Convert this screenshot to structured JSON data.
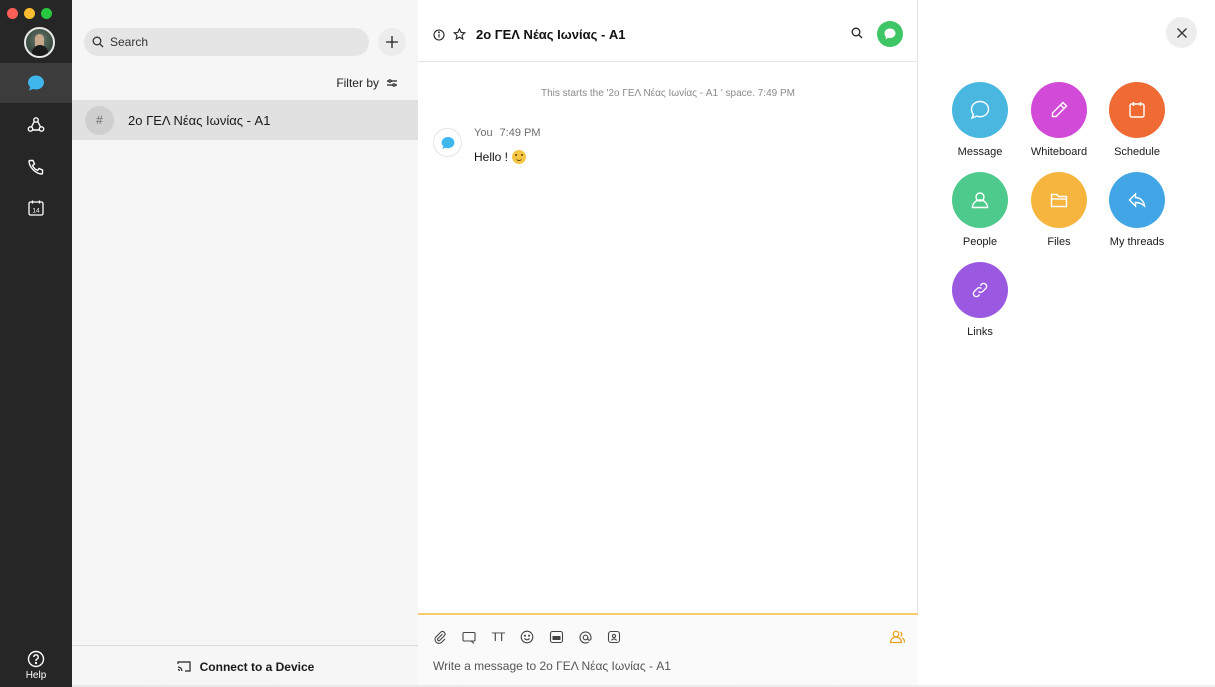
{
  "nav": {
    "help_label": "Help",
    "items": [
      {
        "name": "messaging",
        "icon": "chat-bubble-icon",
        "active": true
      },
      {
        "name": "teams",
        "icon": "teams-icon",
        "active": false
      },
      {
        "name": "calls",
        "icon": "phone-icon",
        "active": false
      },
      {
        "name": "meetings",
        "icon": "calendar-icon",
        "active": false,
        "badge": "14"
      }
    ]
  },
  "spaces": {
    "search_placeholder": "Search",
    "filter_label": "Filter by",
    "items": [
      {
        "prefix": "#",
        "name": "2ο ΓΕΛ Νέας Ιωνίας - A1",
        "selected": true
      }
    ],
    "connect_label": "Connect to a Device"
  },
  "chat": {
    "title": "2ο ΓΕΛ Νέας Ιωνίας - A1",
    "system_message": "This starts the '2ο ΓΕΛ Νέας Ιωνίας - A1 ' space. 7:49 PM",
    "messages": [
      {
        "author": "You",
        "time": "7:49 PM",
        "text": "Hello !",
        "emoji": "slightly-smiling-face"
      }
    ],
    "composer": {
      "placeholder": "Write a message to 2ο ΓΕΛ Νέας Ιωνίας - A1",
      "format_label": "TT",
      "tools": [
        "paperclip-icon",
        "whiteboard-share-icon",
        "text-format-icon",
        "emoji-icon",
        "gif-icon",
        "mention-icon",
        "giphy-badge-icon",
        "people-icon"
      ]
    }
  },
  "activities": [
    {
      "label": "Message",
      "color": "#4ab7e0",
      "icon": "chat-bubble-icon"
    },
    {
      "label": "Whiteboard",
      "color": "#d24bd8",
      "icon": "pencil-icon"
    },
    {
      "label": "Schedule",
      "color": "#f06a33",
      "icon": "calendar-icon"
    },
    {
      "label": "People",
      "color": "#4ecb8c",
      "icon": "person-icon"
    },
    {
      "label": "Files",
      "color": "#f6b53f",
      "icon": "folder-icon"
    },
    {
      "label": "My threads",
      "color": "#42a5e6",
      "icon": "reply-icon"
    },
    {
      "label": "Links",
      "color": "#9a59e0",
      "icon": "link-icon"
    }
  ],
  "colors": {
    "rail": "#262626",
    "accent_green": "#3ec565",
    "composer_border": "#f6cc6a"
  }
}
